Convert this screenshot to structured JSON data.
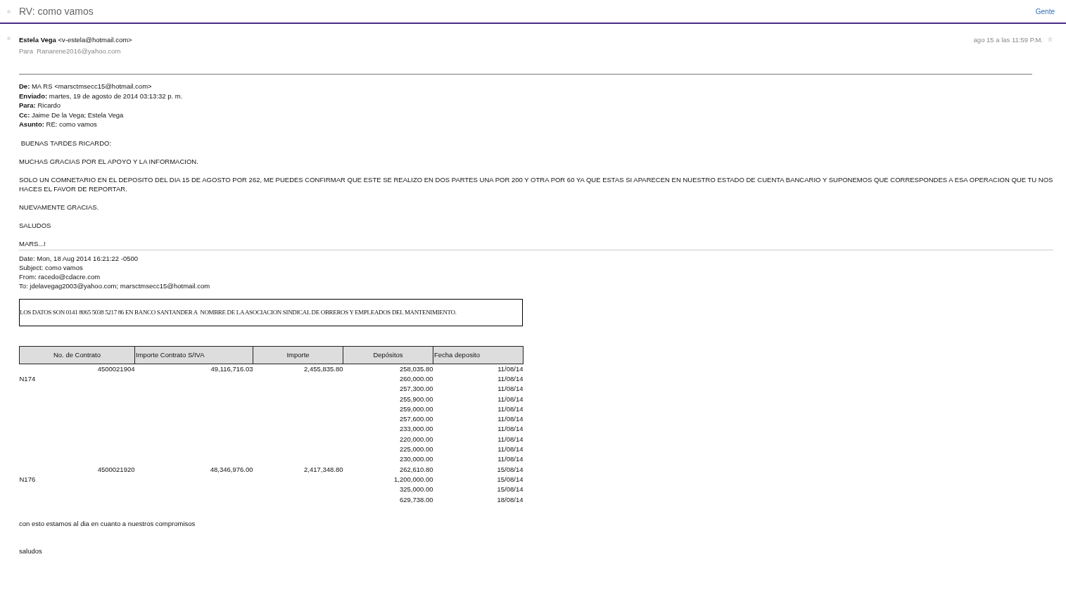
{
  "conversation": {
    "title": "RV: como vamos",
    "people_link": "Gente"
  },
  "message": {
    "sender_name": "Estela Vega",
    "sender_email": "<v-estela@hotmail.com>",
    "recipient_line": "Para  Ranarene2016@yahoo.com",
    "date": "ago 15 a las 11:59 P.M.",
    "starred": false
  },
  "forward_headers": [
    {
      "label": "De:",
      "value": "MA RS <marsctmsecc15@hotmail.com>"
    },
    {
      "label": "Enviado:",
      "value": "martes, 19 de agosto de 2014 03:13:32 p. m."
    },
    {
      "label": "Para:",
      "value": "Ricardo"
    },
    {
      "label": "Cc:",
      "value": "Jaime De la Vega; Estela Vega"
    },
    {
      "label": "Asunto:",
      "value": "RE: como vamos"
    }
  ],
  "body_paragraphs": [
    " BUENAS TARDES RICARDO:",
    "MUCHAS GRACIAS POR EL APOYO Y LA INFORMACION.",
    "SOLO UN COMNETARIO EN EL DEPOSITO DEL DIA 15 DE AGOSTO POR 262, ME PUEDES CONFIRMAR QUE ESTE SE REALIZO EN DOS PARTES UNA POR 200 Y OTRA POR 60 YA QUE ESTAS SI APARECEN EN NUESTRO ESTADO DE CUENTA BANCARIO Y SUPONEMOS QUE CORRESPONDES A ESA OPERACION QUE TU NOS HACES EL FAVOR DE REPORTAR.",
    "NUEVAMENTE GRACIAS.",
    "SALUDOS",
    "MARS...!"
  ],
  "quoted_headers": [
    "Date: Mon, 18 Aug 2014 16:21:22 -0500",
    "Subject: como vamos",
    "From: racedo@cdacre.com",
    "To: jdelavegag2003@yahoo.com; marsctmsecc15@hotmail.com"
  ],
  "account_note": "LOS DATOS SON 0141 8065 5038 5217 86 EN BANCO SANTANDER A  NOMBRE DE LA ASOCIACION SINDICAL DE OBREROS Y EMPLEADOS DEL MANTENIMIENTO.",
  "table": {
    "columns": [
      "No. de Contrato",
      "Importe Contrato S/IVA",
      "Importe",
      "Depósitos",
      "Fecha deposito"
    ],
    "rows": [
      {
        "contract": "4500021904",
        "amount_no_vat": "49,116,716.03",
        "amount": "2,455,835.80",
        "deposit": "258,035.80",
        "date": "11/08/14"
      },
      {
        "contract_note": "N174",
        "deposit": "260,000.00",
        "date": "11/08/14"
      },
      {
        "deposit": "257,300.00",
        "date": "11/08/14"
      },
      {
        "deposit": "255,900.00",
        "date": "11/08/14"
      },
      {
        "deposit": "259,000.00",
        "date": "11/08/14"
      },
      {
        "deposit": "257,600.00",
        "date": "11/08/14"
      },
      {
        "deposit": "233,000.00",
        "date": "11/08/14"
      },
      {
        "deposit": "220,000.00",
        "date": "11/08/14"
      },
      {
        "deposit": "225,000.00",
        "date": "11/08/14"
      },
      {
        "deposit": "230,000.00",
        "date": "11/08/14"
      },
      {
        "contract": "4500021920",
        "amount_no_vat": "48,346,976.00",
        "amount": "2,417,348.80",
        "deposit": "262,610.80",
        "date": "15/08/14"
      },
      {
        "contract_note": "N176",
        "deposit": "1,200,000.00",
        "date": "15/08/14"
      },
      {
        "deposit": "325,000.00",
        "date": "15/08/14"
      },
      {
        "deposit": "629,738.00",
        "date": "18/08/14"
      }
    ]
  },
  "closing": [
    "con esto estamos al dia en cuanto a nuestros compromisos",
    "saludos"
  ]
}
